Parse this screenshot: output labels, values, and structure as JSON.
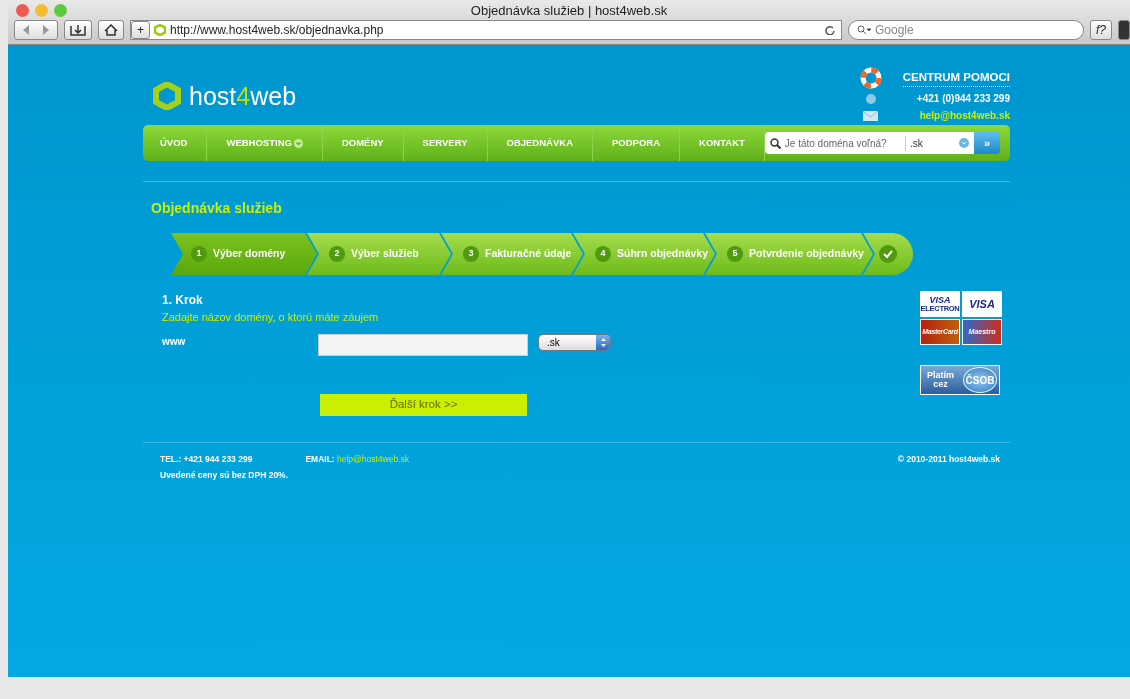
{
  "window": {
    "title": "Objednávka služieb | host4web.sk"
  },
  "toolbar": {
    "add_label": "+",
    "url": "http://www.host4web.sk/objednavka.php",
    "search_placeholder": "Google",
    "button_label": "f?"
  },
  "header": {
    "logo_text": "host",
    "logo_digit": "4",
    "logo_suffix": "web",
    "help_title": "CENTRUM POMOCI",
    "phone": "+421 (0)944 233 299",
    "email": "help@host4web.sk"
  },
  "nav": [
    {
      "label": "ÚVOD",
      "selected": false,
      "dropdown": false
    },
    {
      "label": "WEBHOSTING",
      "selected": false,
      "dropdown": true
    },
    {
      "label": "DOMÉNY",
      "selected": false,
      "dropdown": false
    },
    {
      "label": "SERVERY",
      "selected": false,
      "dropdown": false
    },
    {
      "label": "OBJEDNÁVKA",
      "selected": false,
      "dropdown": false
    },
    {
      "label": "PODPORA",
      "selected": false,
      "dropdown": false
    },
    {
      "label": "KONTAKT",
      "selected": false,
      "dropdown": false
    }
  ],
  "domain_search": {
    "placeholder": "Je táto doména voľná?",
    "tld": ".sk",
    "go": "»"
  },
  "page_title": "Objednávka služieb",
  "steps": [
    {
      "number": "1",
      "label": "Výber domény",
      "selected": true
    },
    {
      "number": "2",
      "label": "Výber služieb",
      "selected": false
    },
    {
      "number": "3",
      "label": "Fakturačné údaje",
      "selected": false
    },
    {
      "number": "4",
      "label": "Súhrn objednávky",
      "selected": false
    },
    {
      "number": "5",
      "label": "Potvrdenie objednávky",
      "selected": false
    }
  ],
  "form": {
    "step_title": "1. Krok",
    "step_hint": "Zadajte názov domény, o ktorú máte záujem",
    "prefix": "www",
    "tld": ".sk",
    "submit": "Ďalší krok >>"
  },
  "payments": {
    "cards": [
      {
        "kind": "visa",
        "text": "VISA",
        "sub": "ELECTRON"
      },
      {
        "kind": "visa",
        "text": "VISA"
      },
      {
        "kind": "mastercard",
        "text": "MasterCard"
      },
      {
        "kind": "maestro",
        "text": "Maestro"
      }
    ],
    "bank_line1": "Platím",
    "bank_line2": "cez",
    "bank_name": "ČSOB"
  },
  "footer": {
    "tel_label": "TEL.:",
    "tel": "+421 944 233 299",
    "email_label": "EMAIL:",
    "email": "help@host4web.sk",
    "note": "Uvedené ceny sú bez DPH 20%.",
    "copyright": "© 2010-2011 host4web.sk"
  }
}
